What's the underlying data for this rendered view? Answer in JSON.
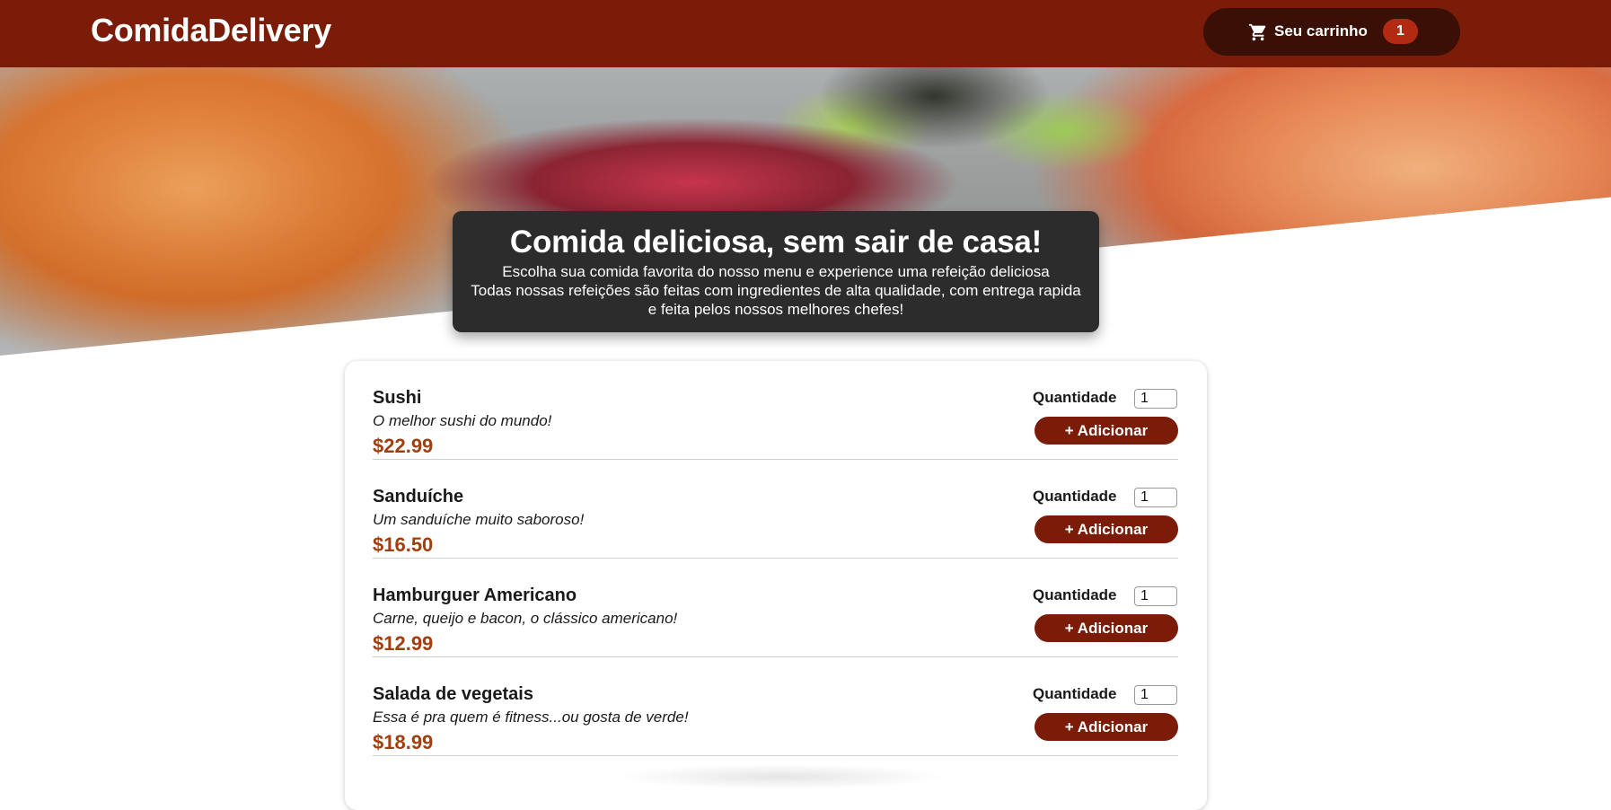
{
  "header": {
    "brand": "ComidaDelivery",
    "cart_label": "Seu carrinho",
    "cart_count": "1",
    "cart_icon": "cart-icon"
  },
  "hero": {
    "title": "Comida deliciosa, sem sair de casa!",
    "line1": "Escolha sua comida favorita do nosso menu e experience uma refeição deliciosa",
    "line2": "Todas nossas refeições são feitas com ingredientes de alta qualidade, com entrega rapida e feita pelos nossos melhores chefes!"
  },
  "menu": {
    "quantity_label": "Quantidade",
    "add_label": "+ Adicionar",
    "items": [
      {
        "name": "Sushi",
        "description": "O melhor sushi do mundo!",
        "price": "$22.99",
        "quantity": "1"
      },
      {
        "name": "Sanduíche",
        "description": "Um sanduíche muito saboroso!",
        "price": "$16.50",
        "quantity": "1"
      },
      {
        "name": "Hamburguer Americano",
        "description": "Carne, queijo e bacon, o clássico americano!",
        "price": "$12.99",
        "quantity": "1"
      },
      {
        "name": "Salada de vegetais",
        "description": "Essa é pra quem é fitness...ou gosta de verde!",
        "price": "$18.99",
        "quantity": "1"
      }
    ]
  },
  "colors": {
    "header_bg": "#7a1c07",
    "cart_bg": "#3a0f06",
    "badge_bg": "#b32a12",
    "price": "#a23f0f",
    "hero_card_bg": "#2c2c2c"
  }
}
